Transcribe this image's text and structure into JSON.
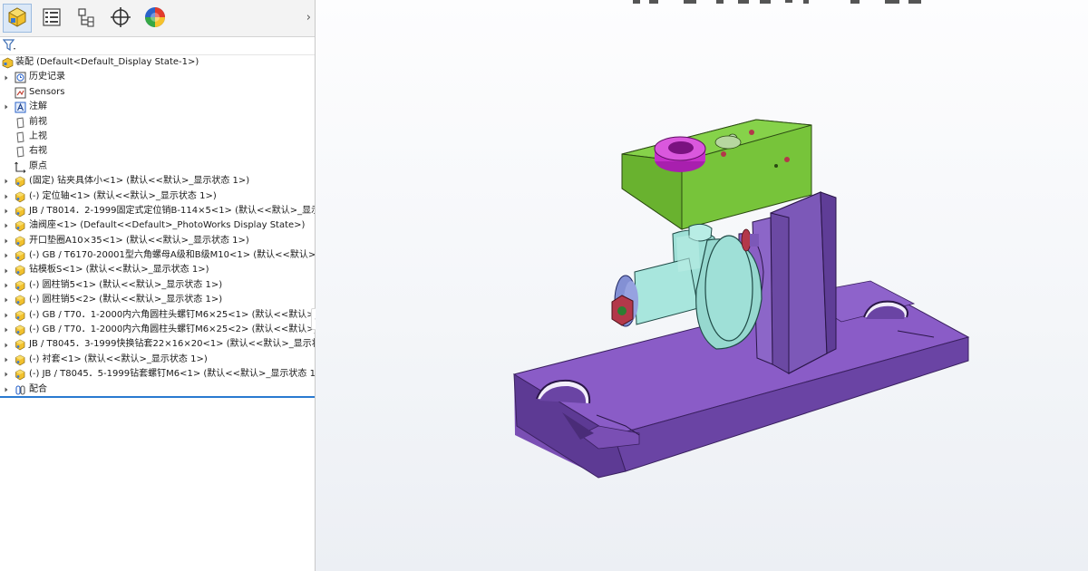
{
  "tabs": [
    {
      "name": "featuremanager-tab-icon"
    },
    {
      "name": "propertymanager-tab-icon"
    },
    {
      "name": "configurationmanager-tab-icon"
    },
    {
      "name": "dimxpert-tab-icon"
    },
    {
      "name": "display-manager-tab-icon"
    }
  ],
  "filter_symbol": "▾",
  "tree": {
    "root": "装配 (Default<Default_Display State-1>)",
    "items": [
      {
        "label": "历史记录",
        "icon": "history-icon",
        "arrow": true
      },
      {
        "label": "Sensors",
        "icon": "sensors-icon",
        "arrow": false
      },
      {
        "label": "注解",
        "icon": "annotations-icon",
        "arrow": true
      },
      {
        "label": "前视",
        "icon": "plane-icon",
        "arrow": false
      },
      {
        "label": "上视",
        "icon": "plane-icon",
        "arrow": false
      },
      {
        "label": "右视",
        "icon": "plane-icon",
        "arrow": false
      },
      {
        "label": "原点",
        "icon": "origin-icon",
        "arrow": false
      },
      {
        "label": "(固定) 钻夹具体小<1> (默认<<默认>_显示状态 1>)",
        "icon": "part-icon",
        "arrow": true
      },
      {
        "label": "(-) 定位轴<1> (默认<<默认>_显示状态 1>)",
        "icon": "part-icon",
        "arrow": true
      },
      {
        "label": "JB / T8014．2-1999固定式定位销B-114×5<1> (默认<<默认>_显示状态",
        "icon": "part-icon",
        "arrow": true
      },
      {
        "label": "油阀座<1> (Default<<Default>_PhotoWorks Display State>)",
        "icon": "part-icon",
        "arrow": true
      },
      {
        "label": "开口垫圈A10×35<1> (默认<<默认>_显示状态 1>)",
        "icon": "part-icon",
        "arrow": true
      },
      {
        "label": "(-) GB / T6170-20001型六角螺母A级和B级M10<1> (默认<<默认>_显示",
        "icon": "part-icon",
        "arrow": true
      },
      {
        "label": "钻模板S<1> (默认<<默认>_显示状态 1>)",
        "icon": "part-icon",
        "arrow": true
      },
      {
        "label": "(-) 圆柱销5<1> (默认<<默认>_显示状态 1>)",
        "icon": "part-icon",
        "arrow": true
      },
      {
        "label": "(-) 圆柱销5<2> (默认<<默认>_显示状态 1>)",
        "icon": "part-icon",
        "arrow": true
      },
      {
        "label": "(-) GB / T70．1-2000内六角圆柱头螺钉M6×25<1> (默认<<默认>_显示",
        "icon": "part-icon",
        "arrow": true
      },
      {
        "label": "(-) GB / T70．1-2000内六角圆柱头螺钉M6×25<2> (默认<<默认>_显示",
        "icon": "part-icon",
        "arrow": true
      },
      {
        "label": "JB / T8045．3-1999快换钻套22×16×20<1> (默认<<默认>_显示状态 1>",
        "icon": "part-icon",
        "arrow": true
      },
      {
        "label": "(-) 衬套<1> (默认<<默认>_显示状态 1>)",
        "icon": "part-icon",
        "arrow": true
      },
      {
        "label": "(-) JB / T8045．5-1999钻套螺钉M6<1> (默认<<默认>_显示状态 1>)",
        "icon": "part-icon",
        "arrow": true
      },
      {
        "label": "配合",
        "icon": "mates-icon",
        "arrow": true
      }
    ]
  },
  "collapse_handle": "«",
  "expand_symbol": "›",
  "colors": {
    "base_plate": "#7a4fb4",
    "column": "#7c58b8",
    "drill_plate": "#77c43a",
    "bushing": "#c52ec9",
    "valve_body": "#9fe0d7",
    "washer": "#8390d4",
    "nut": "#b3384a",
    "tree_border": "#2a7ad0"
  }
}
